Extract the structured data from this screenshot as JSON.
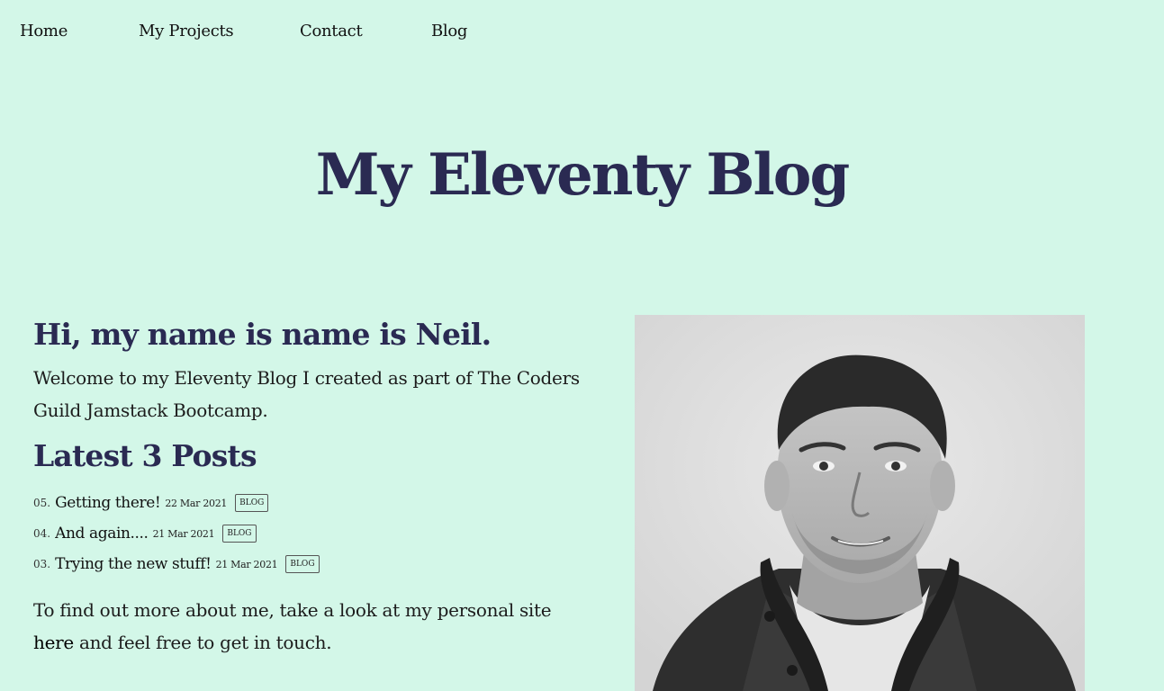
{
  "nav": {
    "items": [
      {
        "label": "Home"
      },
      {
        "label": "My Projects"
      },
      {
        "label": "Contact"
      },
      {
        "label": "Blog"
      }
    ]
  },
  "site": {
    "title": "My Eleventy Blog"
  },
  "main": {
    "greeting": "Hi, my name is name is Neil.",
    "intro": "Welcome to my Eleventy Blog I created as part of The Coders Guild Jamstack Bootcamp.",
    "posts_heading": "Latest 3 Posts",
    "posts": [
      {
        "num": "05.",
        "title": "Getting there!",
        "date": "22 Mar 2021",
        "tag": "BLOG"
      },
      {
        "num": "04.",
        "title": "And again....",
        "date": "21 Mar 2021",
        "tag": "BLOG"
      },
      {
        "num": "03.",
        "title": "Trying the new stuff!",
        "date": "21 Mar 2021",
        "tag": "BLOG"
      }
    ],
    "outro_before": "To find out more about me, take a look at my personal site ",
    "outro_link": "here",
    "outro_after": " and feel free to get in touch."
  },
  "colors": {
    "background": "#d3f7e8",
    "heading": "#2a2a52"
  },
  "icons": {
    "photo": "profile-photo"
  }
}
